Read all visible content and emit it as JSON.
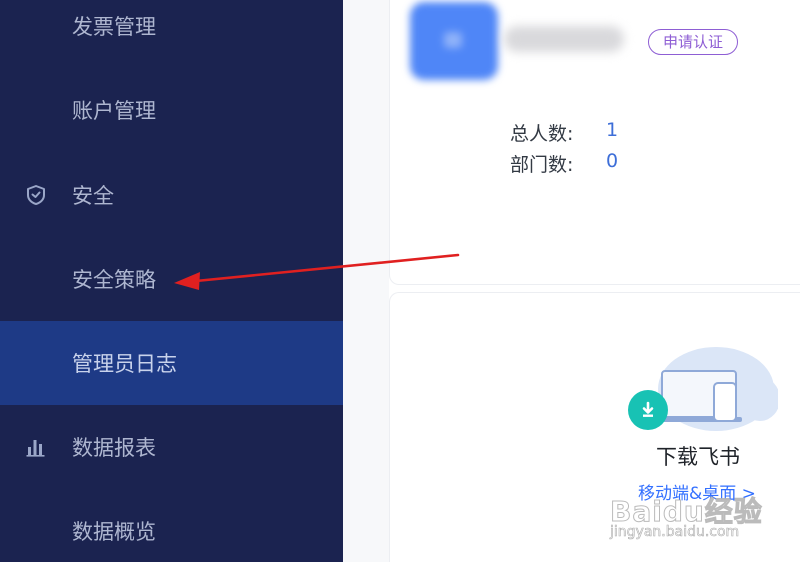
{
  "sidebar": {
    "items": [
      {
        "label": "发票管理",
        "kind": "sub",
        "icon": null
      },
      {
        "label": "账户管理",
        "kind": "sub",
        "icon": null
      },
      {
        "label": "安全",
        "kind": "group",
        "icon": "shield-icon"
      },
      {
        "label": "安全策略",
        "kind": "sub",
        "icon": null
      },
      {
        "label": "管理员日志",
        "kind": "sub",
        "active": true,
        "icon": null
      },
      {
        "label": "数据报表",
        "kind": "group",
        "icon": "bar-chart-icon"
      },
      {
        "label": "数据概览",
        "kind": "sub",
        "icon": null
      }
    ]
  },
  "org": {
    "certify_label": "申请认证",
    "stats": [
      {
        "label": "总人数:",
        "value": "1"
      },
      {
        "label": "部门数:",
        "value": "0"
      }
    ]
  },
  "download": {
    "title": "下载飞书",
    "link": "移动端&桌面 >"
  },
  "watermark": {
    "logo": "Baidu经验",
    "url": "jingyan.baidu.com"
  },
  "colors": {
    "sidebar_bg": "#1b2350",
    "sidebar_active_bg": "#1e3a86",
    "sidebar_text": "#aeb6d0",
    "accent_blue": "#3370ff",
    "certify_purple": "#8e5ed4",
    "annotation_arrow": "#e02020",
    "download_teal": "#18c2b4"
  }
}
